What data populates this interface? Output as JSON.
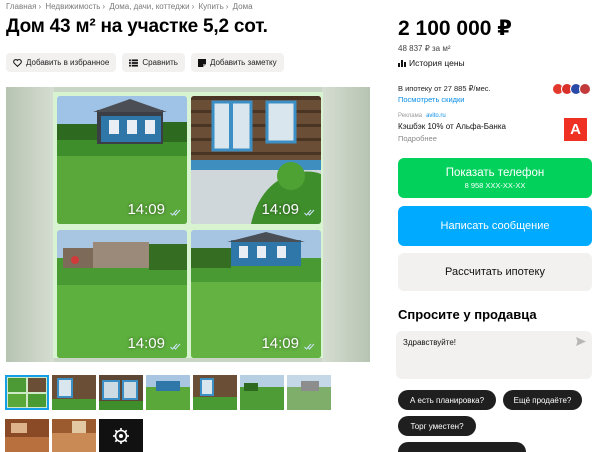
{
  "breadcrumbs": [
    "Главная",
    "Недвижимость",
    "Дома, дачи, коттеджи",
    "Купить",
    "Дома"
  ],
  "breadcrumb_sep": "›",
  "title": "Дом 43 м² на участке 5,2 сот.",
  "actions": {
    "favorite": "Добавить в избранное",
    "compare": "Сравнить",
    "note": "Добавить заметку"
  },
  "gallery": {
    "tiles": [
      {
        "time": "14:09"
      },
      {
        "time": "14:09"
      },
      {
        "time": "14:09"
      },
      {
        "time": "14:09"
      }
    ],
    "thumbnail_count": 10,
    "more_icon": "gear-icon"
  },
  "price": {
    "value": "2 100 000 ₽",
    "per_m2": "48 837 ₽ за м²",
    "history": "История цены"
  },
  "mortgage": {
    "text": "В ипотеку от 27 885 ₽/мес.",
    "link": "Посмотреть скидки"
  },
  "ad": {
    "label": "Реклама",
    "source": "avito.ru",
    "cashback": "Кэшбэк 10% от Альфа-Банка",
    "more": "Подробнее",
    "bank_logo": "А"
  },
  "buttons": {
    "call": "Показать телефон",
    "phone": "8 958 XXX-XX-XX",
    "message": "Написать сообщение",
    "mortgage": "Рассчитать ипотеку"
  },
  "ask": {
    "title": "Спросите у продавца",
    "placeholder": "Здравствуйте!",
    "chips": [
      "А есть планировка?",
      "Ещё продаёте?",
      "Торг уместен?"
    ]
  },
  "colors": {
    "green": "#02d15c",
    "blue": "#00aaff",
    "link": "#0a8ee6",
    "alfa_red": "#ef3124"
  }
}
